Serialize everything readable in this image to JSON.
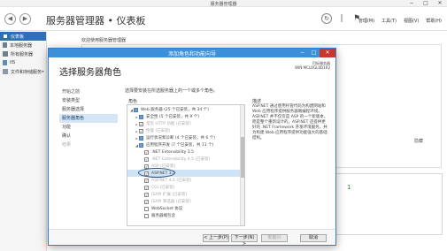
{
  "server_manager": {
    "window_title": "服务器管理器",
    "window_controls": [
      "−",
      "□",
      "✕"
    ],
    "breadcrumb": "服务器管理器 • 仪表板",
    "menu": [
      "管理(M)",
      "工具(T)",
      "视图(V)",
      "帮助(H)"
    ],
    "icons": [
      "back-icon",
      "forward-icon",
      "refresh-icon",
      "flag-icon"
    ]
  },
  "sidebar": {
    "items": [
      {
        "label": "仪表板",
        "icon": "dashboard-icon",
        "active": true
      },
      {
        "label": "本地服务器",
        "icon": "local-server-icon"
      },
      {
        "label": "所有服务器",
        "icon": "all-servers-icon"
      },
      {
        "label": "IIS",
        "icon": "iis-icon"
      },
      {
        "label": "文件和存储服务",
        "icon": "file-storage-icon",
        "chevron": "▸"
      }
    ]
  },
  "content": {
    "welcome": "欢迎使用服务器管理器",
    "hide_label": "隐藏",
    "card_count": "1"
  },
  "wizard": {
    "title": "添加角色和功能向导",
    "heading": "选择服务器角色",
    "target_label": "目标服务器",
    "target_server": "WIN-MCLOGL0D1R2",
    "steps": [
      {
        "label": "开始之前",
        "state": "normal"
      },
      {
        "label": "安装类型",
        "state": "normal"
      },
      {
        "label": "服务器选择",
        "state": "normal"
      },
      {
        "label": "服务器角色",
        "state": "active"
      },
      {
        "label": "功能",
        "state": "normal"
      },
      {
        "label": "确认",
        "state": "normal"
      },
      {
        "label": "结果",
        "state": "dim"
      }
    ],
    "instruction": "选择要安装在所选服务器上的一个或多个角色。",
    "roles_header": "角色",
    "desc_header": "描述",
    "description": "ASP.NET 通过使用托管代码为构建网站和 Web 应用程序提供服务器端编程环境。ASP.NET 并不仅仅是 ASP 的一个新版本，而是整个重新设计的，ASP.NET 还提供更好的 .NET Framework 开发环境服务，并为构建 Web 应用程序提供功能强大的基础结构。",
    "tree": [
      {
        "text": "Web 服务器 (25 个已安装，共 34 个)",
        "indent": 1,
        "exp": "◢",
        "check": "fill"
      },
      {
        "text": "安全性 (5 个已安装，共 9 个)",
        "indent": 2,
        "exp": "▸",
        "check": "fill"
      },
      {
        "text": "常见 HTTP 功能 (已安装)",
        "indent": 2,
        "exp": "▸",
        "check": "check",
        "dim": true
      },
      {
        "text": "性能 (已安装)",
        "indent": 2,
        "exp": "▸",
        "check": "check",
        "dim": true
      },
      {
        "text": "运行状况和诊断 (4 个已安装，共 6 个)",
        "indent": 2,
        "exp": "▸",
        "check": "fill"
      },
      {
        "text": "应用程序开发 (7 个已安装，共 11 个)",
        "indent": 2,
        "exp": "◢",
        "check": "fill"
      },
      {
        "text": ".NET Extensibility 3.5",
        "indent": 3,
        "exp": "",
        "check": "check"
      },
      {
        "text": ".NET Extensibility 4.5 (已安装)",
        "indent": 3,
        "exp": "",
        "check": "check",
        "dim": true
      },
      {
        "text": "ASP (已安装)",
        "indent": 3,
        "exp": "",
        "check": "check",
        "dim": true
      },
      {
        "text": "ASP.NET 3.5",
        "indent": 3,
        "exp": "",
        "check": "check",
        "selected": true
      },
      {
        "text": "ASP.NET 4.5 (已安装)",
        "indent": 3,
        "exp": "",
        "check": "check",
        "dim": true
      },
      {
        "text": "CGI (已安装)",
        "indent": 3,
        "exp": "",
        "check": "check",
        "dim": true
      },
      {
        "text": "ISAPI 扩展 (已安装)",
        "indent": 3,
        "exp": "",
        "check": "check",
        "dim": true
      },
      {
        "text": "ISAPI 筛选器 (已安装)",
        "indent": 3,
        "exp": "",
        "check": "check",
        "dim": true
      },
      {
        "text": "WebSocket 协议",
        "indent": 3,
        "exp": "",
        "check": "empty"
      },
      {
        "text": "服务器端包含",
        "indent": 3,
        "exp": "",
        "check": "empty"
      }
    ],
    "buttons": {
      "prev": "< 上一步(P)",
      "next": "下一步(N) >",
      "install": "安装(I)",
      "cancel": "取消"
    },
    "accent_color": "#3c8fd9"
  }
}
